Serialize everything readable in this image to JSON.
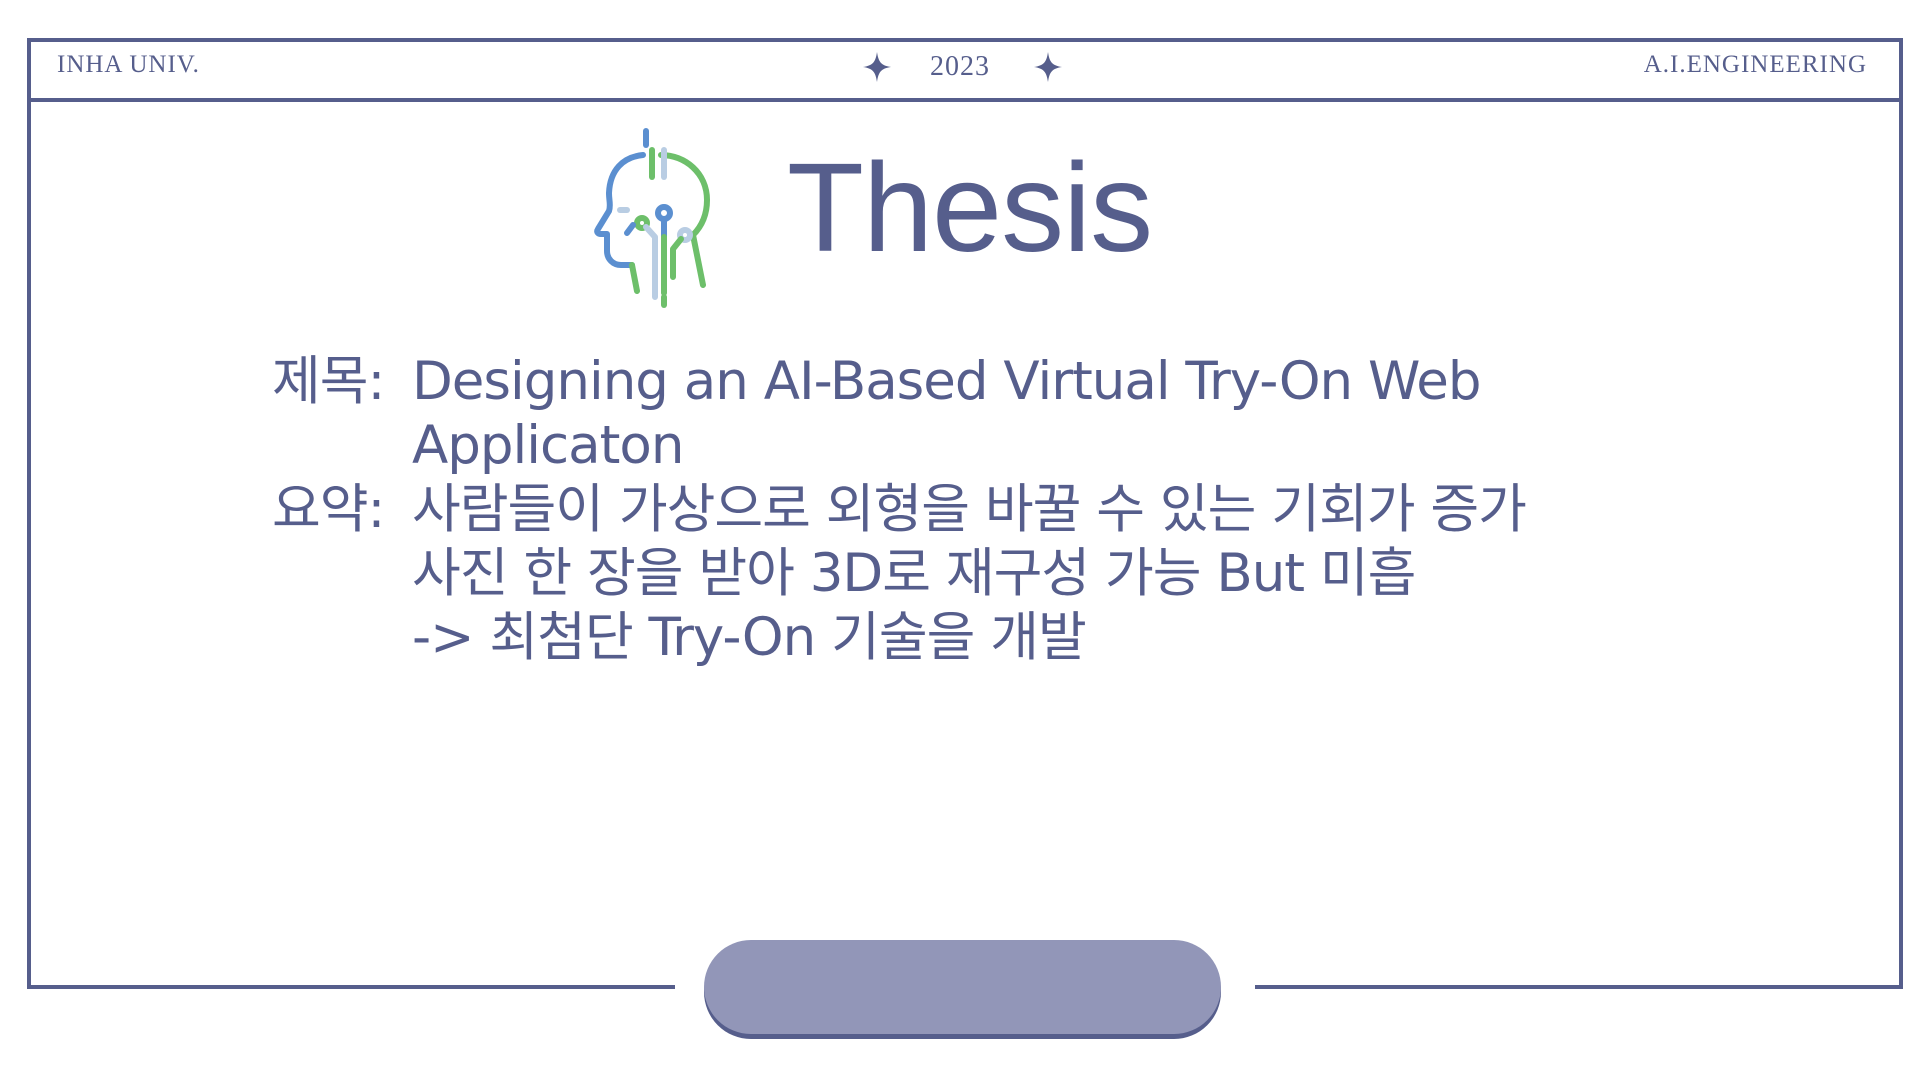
{
  "header": {
    "left": "INHA UNIV.",
    "center": "2023",
    "right": "A.I.ENGINEERING"
  },
  "title": "Thesis",
  "content": {
    "title_label": "제목:",
    "title_line1": "Designing an AI-Based Virtual Try-On Web",
    "title_line2": "Applicaton",
    "summary_label": "요약:",
    "summary_line1": "사람들이 가상으로 외형을 바꿀 수 있는 기회가 증가",
    "summary_line2": "사진 한 장을 받아 3D로 재구성 가능 But 미흡",
    "summary_line3": "-> 최첨단 Try-On 기술을 개발"
  },
  "colors": {
    "primary": "#565e8c",
    "pill": "#9296b8",
    "logo_blue": "#5b8fd0",
    "logo_green": "#6dbf6a",
    "logo_light": "#b9cde3"
  },
  "icons": [
    "ai-head-icon",
    "sparkle-star-icon"
  ]
}
